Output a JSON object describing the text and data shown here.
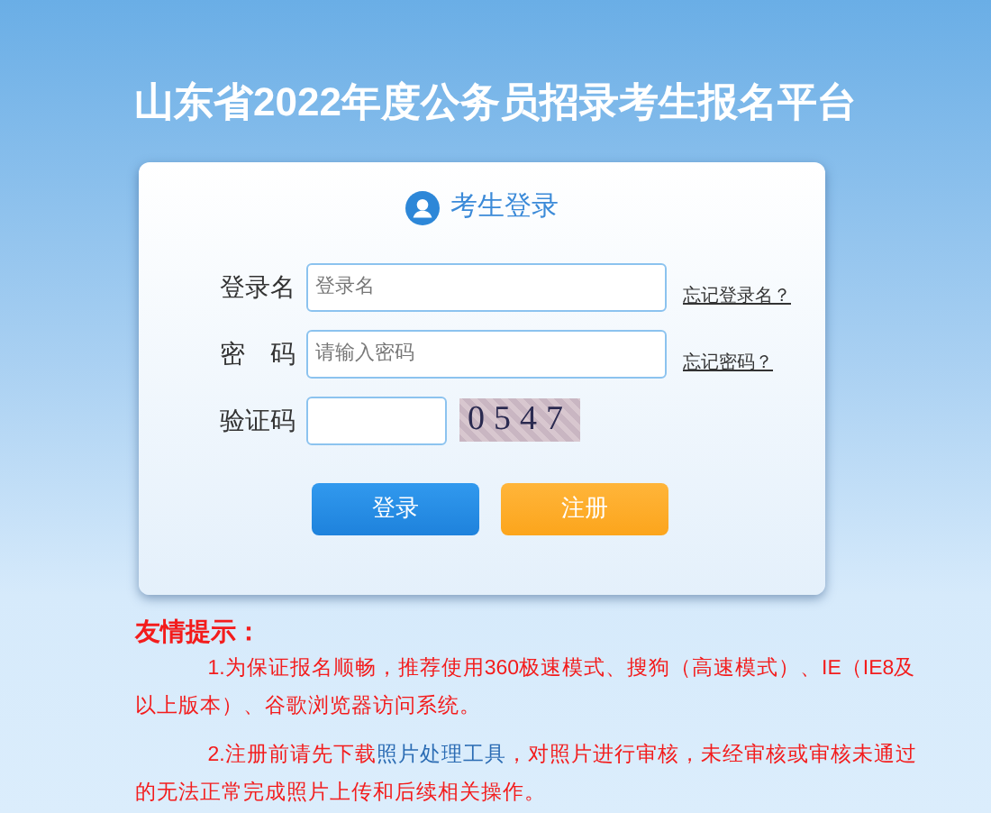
{
  "title": "山东省2022年度公务员招录考生报名平台",
  "login": {
    "heading": "考生登录",
    "fields": [
      {
        "label": "登录名",
        "placeholder": "登录名",
        "link": "忘记登录名？"
      },
      {
        "label": "密　码",
        "placeholder": "请输入密码",
        "link": "忘记密码？"
      },
      {
        "label": "验证码",
        "captcha": "0547"
      }
    ],
    "buttons": [
      {
        "label": "登录",
        "kind": "primary"
      },
      {
        "label": "注册",
        "kind": "warning"
      }
    ]
  },
  "tips": {
    "heading": "友情提示：",
    "notes": [
      [
        {
          "text": "1.为保证报名顺畅，推荐使用360极速模式、搜狗（高速模式）、IE（IE8及以上版本）、谷歌浏览器访问系统。"
        }
      ],
      [
        {
          "text": "2.注册前请先下载"
        },
        {
          "text": "照片处理工具",
          "kind": "link"
        },
        {
          "text": "，对照片进行审核，未经审核或审核未通过的无法正常完成照片上传和后续相关操作。"
        }
      ]
    ]
  }
}
